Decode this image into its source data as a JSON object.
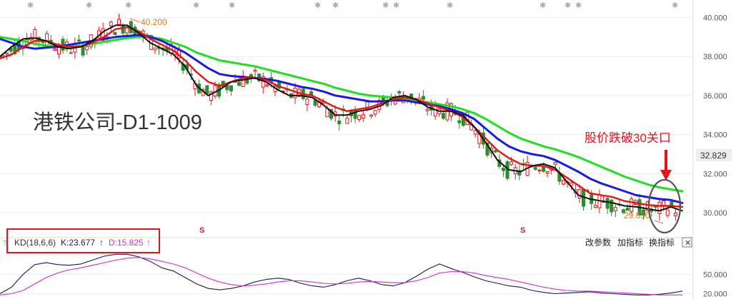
{
  "stock_title": "港铁公司-D1-1009",
  "annotation": "股价跌破30关口",
  "high_marker": "40.200",
  "low_marker": "29.650",
  "current_price": "32.829",
  "split_markers": [
    "S",
    "S"
  ],
  "toolbar": {
    "params_label": "改参数",
    "add_indicator_label": "加指标",
    "switch_indicator_label": "换指标",
    "close_label": "✕"
  },
  "kd_legend": {
    "name": "KD(18,6,6)",
    "k_text": "K:23.677",
    "d_text": "D:15.825",
    "k_arrow": "↑",
    "d_arrow": "↑"
  },
  "colors": {
    "up": "#e8141b",
    "down": "#2e8b2e",
    "ma_black": "#111111",
    "ma_red": "#e81414",
    "ma_blue": "#1a1ae6",
    "ma_green": "#1ee01e",
    "k_line": "#1a1a55",
    "d_line": "#d62ad6",
    "highlight": "#e81414"
  },
  "chart_data": [
    {
      "type": "candlestick",
      "y_ticks": [
        "40.000",
        "38.000",
        "36.000",
        "34.000",
        "32.000",
        "30.000"
      ],
      "ylim": [
        29.2,
        40.6
      ],
      "moving_averages": [
        {
          "color": "black",
          "values": [
            38.0,
            38.5,
            38.9,
            38.95,
            38.8,
            38.5,
            38.4,
            38.5,
            38.8,
            39.3,
            39.6,
            39.6,
            39.2,
            38.7,
            38.4,
            38.1,
            37.5,
            36.5,
            36.0,
            36.3,
            36.7,
            36.8,
            36.9,
            36.7,
            36.3,
            36.0,
            36.0,
            35.9,
            35.5,
            35.0,
            35.0,
            35.2,
            35.3,
            35.5,
            35.9,
            36.0,
            35.8,
            35.4,
            35.2,
            35.2,
            35.0,
            34.4,
            33.6,
            32.7,
            32.2,
            32.1,
            32.4,
            32.5,
            32.3,
            31.6,
            30.9,
            30.7,
            30.6,
            30.5,
            30.35,
            30.3,
            30.2,
            30.1,
            30.3,
            30.1
          ]
        },
        {
          "color": "red",
          "values": [
            37.9,
            38.1,
            38.5,
            38.8,
            38.8,
            38.6,
            38.5,
            38.5,
            38.7,
            39.0,
            39.4,
            39.5,
            39.3,
            38.9,
            38.6,
            38.3,
            37.8,
            37.2,
            36.7,
            36.5,
            36.7,
            36.9,
            36.9,
            36.8,
            36.5,
            36.3,
            36.1,
            36.0,
            35.7,
            35.4,
            35.2,
            35.3,
            35.4,
            35.6,
            35.8,
            35.9,
            35.8,
            35.6,
            35.4,
            35.2,
            34.9,
            34.4,
            33.8,
            33.2,
            32.8,
            32.5,
            32.4,
            32.4,
            32.2,
            31.8,
            31.4,
            31.0,
            30.9,
            30.8,
            30.6,
            30.5,
            30.4,
            30.35,
            30.35,
            30.3
          ]
        },
        {
          "color": "blue",
          "values": [
            38.9,
            38.7,
            38.5,
            38.4,
            38.45,
            38.5,
            38.6,
            38.7,
            38.8,
            38.9,
            39.0,
            39.05,
            39.1,
            39.0,
            38.8,
            38.5,
            38.2,
            37.8,
            37.4,
            37.1,
            37.0,
            36.95,
            36.9,
            36.85,
            36.75,
            36.6,
            36.45,
            36.35,
            36.2,
            36.0,
            35.9,
            35.8,
            35.7,
            35.7,
            35.75,
            35.75,
            35.65,
            35.55,
            35.45,
            35.3,
            35.1,
            34.8,
            34.3,
            33.8,
            33.4,
            33.15,
            33.0,
            32.9,
            32.7,
            32.4,
            32.1,
            31.75,
            31.5,
            31.3,
            31.1,
            30.9,
            30.8,
            30.7,
            30.65,
            30.5
          ]
        },
        {
          "color": "green",
          "values": [
            39.0,
            38.9,
            38.8,
            38.65,
            38.55,
            38.5,
            38.5,
            38.55,
            38.65,
            38.75,
            38.85,
            38.95,
            39.0,
            39.0,
            38.9,
            38.7,
            38.5,
            38.2,
            38.0,
            37.8,
            37.7,
            37.6,
            37.5,
            37.35,
            37.2,
            37.05,
            36.9,
            36.75,
            36.6,
            36.4,
            36.25,
            36.1,
            36.0,
            35.95,
            35.9,
            35.85,
            35.75,
            35.65,
            35.55,
            35.45,
            35.3,
            35.1,
            34.8,
            34.45,
            34.1,
            33.8,
            33.6,
            33.4,
            33.25,
            33.05,
            32.85,
            32.6,
            32.35,
            32.1,
            31.85,
            31.65,
            31.45,
            31.3,
            31.2,
            31.1
          ]
        }
      ]
    },
    {
      "type": "line",
      "title": "KD(18,6,6)",
      "y_ticks": [
        "50.000",
        "20.000"
      ],
      "ylim": [
        15,
        88
      ],
      "series": [
        {
          "name": "K",
          "values": [
            20,
            30,
            50,
            65,
            68,
            65,
            64,
            66,
            72,
            78,
            81,
            81,
            77,
            70,
            60,
            55,
            45,
            35,
            28,
            26,
            28,
            32,
            38,
            42,
            44,
            42,
            36,
            32,
            30,
            34,
            40,
            44,
            40,
            34,
            32,
            37,
            47,
            58,
            66,
            59,
            53,
            46,
            40,
            36,
            32,
            30,
            25,
            22,
            20,
            21,
            22,
            23,
            21,
            20,
            19,
            18,
            18,
            19,
            21,
            24
          ]
        },
        {
          "name": "D",
          "values": [
            18,
            20,
            25,
            35,
            45,
            52,
            57,
            60,
            64,
            68,
            72,
            75,
            76,
            74,
            70,
            66,
            60,
            52,
            44,
            38,
            34,
            32,
            33,
            35,
            38,
            40,
            40,
            38,
            36,
            35,
            36,
            38,
            39,
            38,
            37,
            37,
            40,
            45,
            52,
            54,
            54,
            52,
            48,
            45,
            42,
            38,
            34,
            30,
            27,
            25,
            24,
            24,
            23,
            22,
            21,
            20,
            19,
            18,
            18,
            18
          ]
        }
      ]
    }
  ]
}
